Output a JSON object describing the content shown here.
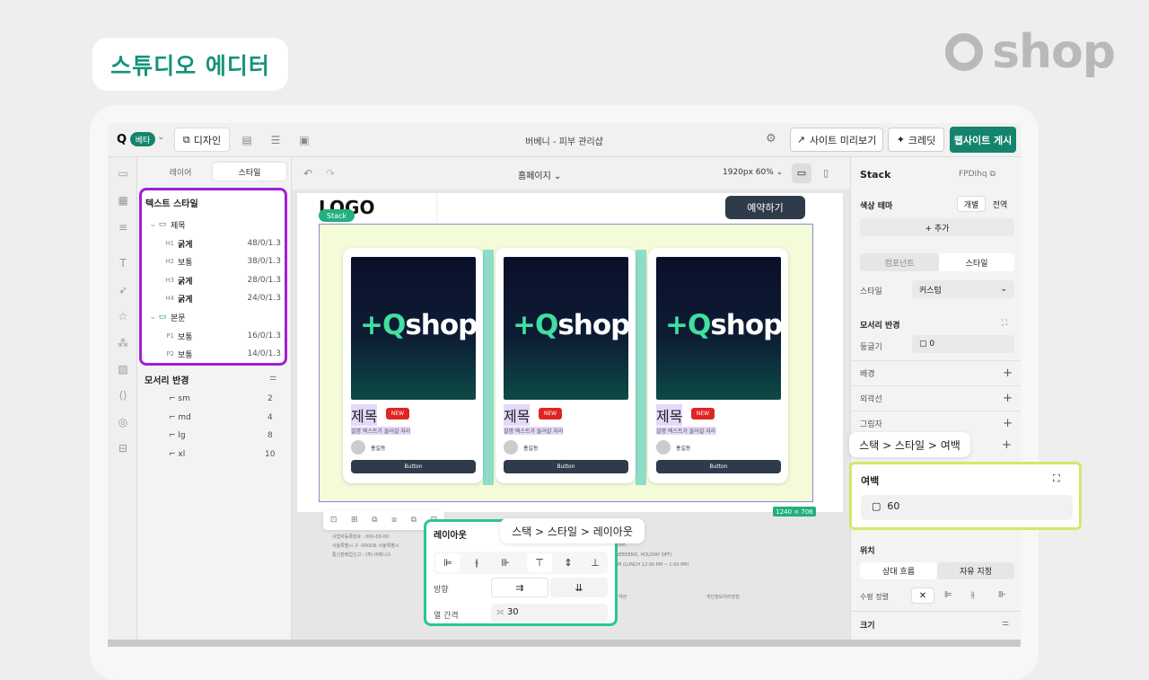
{
  "header": {
    "title": "스튜디오 에디터",
    "brand": "shop"
  },
  "topbar": {
    "logo": "Q",
    "beta": "베타",
    "design_tab": "디자인",
    "document_title": "버베니 - 피부 관리샵",
    "preview": "사이트 미리보기",
    "credit": "크레딧",
    "publish": "웹사이트 게시"
  },
  "left_panel": {
    "tabs": [
      "레이어",
      "스타일"
    ],
    "text_style_title": "텍스트 스타일",
    "groups": [
      {
        "name": "제목",
        "items": [
          {
            "tag": "H1",
            "label": "굵게",
            "value": "48/0/1.3",
            "bold": true
          },
          {
            "tag": "H2",
            "label": "보통",
            "value": "38/0/1.3",
            "bold": false
          },
          {
            "tag": "H3",
            "label": "굵게",
            "value": "28/0/1.3",
            "bold": true
          },
          {
            "tag": "H4",
            "label": "굵게",
            "value": "24/0/1.3",
            "bold": true
          }
        ]
      },
      {
        "name": "본문",
        "items": [
          {
            "tag": "P1",
            "label": "보통",
            "value": "16/0/1.3",
            "bold": false
          },
          {
            "tag": "P2",
            "label": "보통",
            "value": "14/0/1.3",
            "bold": false
          }
        ]
      }
    ],
    "radius_title": "모서리 반경",
    "radius_items": [
      {
        "label": "sm",
        "value": "2"
      },
      {
        "label": "md",
        "value": "4"
      },
      {
        "label": "lg",
        "value": "8"
      },
      {
        "label": "xl",
        "value": "10"
      }
    ]
  },
  "canvas": {
    "page_name": "홈페이지",
    "zoom": "1920px 60%",
    "site_logo": "LOGO",
    "reserve_button": "예약하기",
    "stack_tag": "Stack",
    "size_badge": "1240 × 706",
    "cards": [
      {
        "title": "제목",
        "badge": "NEW",
        "desc": "설명 텍스트가 들어갈 자리",
        "author": "홍길동",
        "button": "Button",
        "image_text": "shop"
      },
      {
        "title": "제목",
        "badge": "NEW",
        "desc": "설명 텍스트가 들어갈 자리",
        "author": "홍길동",
        "button": "Button",
        "image_text": "shop"
      },
      {
        "title": "제목",
        "badge": "NEW",
        "desc": "설명 텍스트가 들어갈 자리",
        "author": "홍길동",
        "button": "Button",
        "image_text": "shop"
      }
    ],
    "footer_lines": [
      "상호 : 버베니 | 대표자 : 홍길동",
      "사업자등록번호 : 000-00-00",
      "서울특별시 구 -0000로 서울특별시",
      "통신판매업신고 : (주) 버베니스",
      ".com",
      "WEEKEND, HOLIDAY OFF)",
      "PM (LUNCH 12:00 PM ~ 1:00 PM)",
      "약관",
      "개인정보처리방침"
    ]
  },
  "layout_popup": {
    "title": "레이아웃",
    "direction_label": "방향",
    "gap_label": "열 간격",
    "gap_value": "30"
  },
  "right_panel": {
    "title": "Stack",
    "id": "FPDIhq",
    "color_theme": "색상 테마",
    "theme_options": [
      "개별",
      "전역"
    ],
    "add": "+ 추가",
    "tabs": [
      "컴포넌트",
      "스타일"
    ],
    "style_label": "스타일",
    "style_value": "커스텀",
    "corner_title": "모서리 반경",
    "corner_label": "둥글기",
    "corner_value": "0",
    "rows": [
      "배경",
      "외곽선",
      "그림자"
    ],
    "padding_title": "여백",
    "padding_value": "60",
    "position_title": "위치",
    "position_options": [
      "상대 흐름",
      "자유 지정"
    ],
    "align_label": "수평 정렬",
    "size_title": "크기"
  },
  "tooltips": {
    "padding_path": "스택 > 스타일 > 여백",
    "layout_path": "스택 > 스타일 > 레이아웃"
  }
}
